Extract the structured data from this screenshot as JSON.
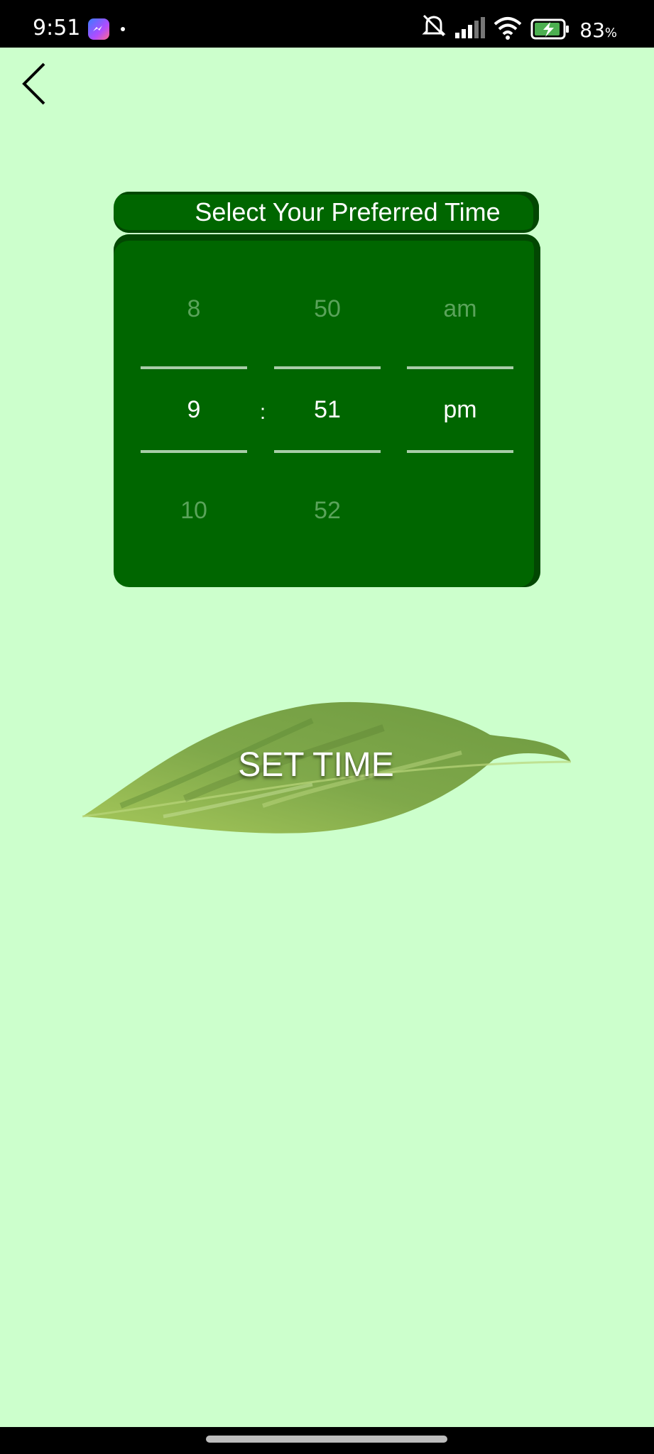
{
  "status_bar": {
    "time": "9:51",
    "battery_percent": "83",
    "battery_percent_sign": "%",
    "icons": [
      "messenger-icon",
      "notification-dot",
      "silent-icon",
      "signal-icon",
      "wifi-icon",
      "battery-charging-icon"
    ],
    "battery_level": 0.83
  },
  "navigation": {
    "back_icon": "chevron-left-icon"
  },
  "picker": {
    "title": "Select Your Preferred Time",
    "separator": ":",
    "hour": {
      "prev": "8",
      "selected": "9",
      "next": "10"
    },
    "minute": {
      "prev": "50",
      "selected": "51",
      "next": "52"
    },
    "period": {
      "prev": "am",
      "selected": "pm",
      "next": ""
    }
  },
  "set_time_button": {
    "label": "SET TIME",
    "icon": "leaf-icon"
  },
  "colors": {
    "background": "#ccffcc",
    "card": "#006600",
    "card_shadow": "#024702",
    "dim_text": "#5aa35a",
    "divider": "#a8cda8"
  }
}
